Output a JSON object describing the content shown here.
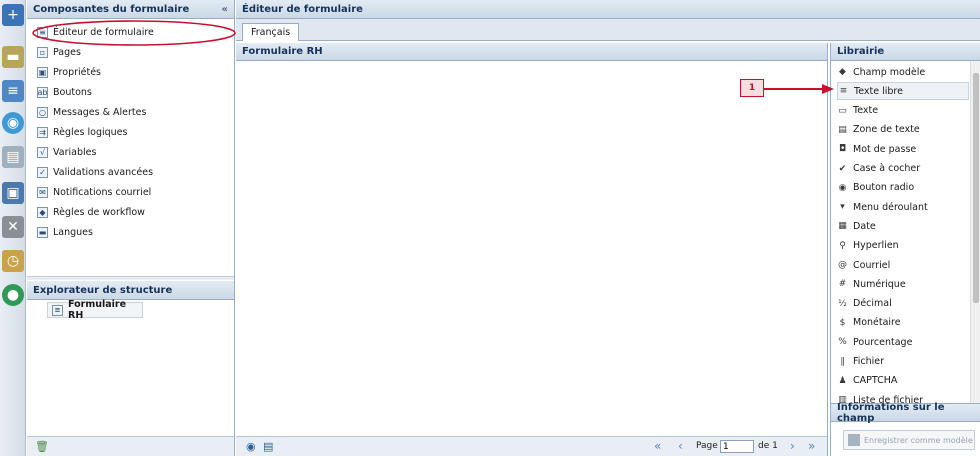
{
  "left_panel": {
    "title": "Composantes du formulaire",
    "collapse": "«",
    "items": [
      {
        "label": "Éditeur de formulaire",
        "icon": "form-editor-icon"
      },
      {
        "label": "Pages",
        "icon": "pages-icon"
      },
      {
        "label": "Propriétés",
        "icon": "properties-icon"
      },
      {
        "label": "Boutons",
        "icon": "buttons-icon"
      },
      {
        "label": "Messages & Alertes",
        "icon": "messages-icon"
      },
      {
        "label": "Règles logiques",
        "icon": "logic-rules-icon"
      },
      {
        "label": "Variables",
        "icon": "variables-icon"
      },
      {
        "label": "Validations avancées",
        "icon": "validations-icon"
      },
      {
        "label": "Notifications courriel",
        "icon": "email-notifications-icon"
      },
      {
        "label": "Règles de workflow",
        "icon": "workflow-rules-icon"
      },
      {
        "label": "Langues",
        "icon": "languages-icon"
      }
    ]
  },
  "explorer": {
    "title": "Explorateur de structure",
    "root": "Formulaire RH"
  },
  "editor": {
    "title": "Éditeur de formulaire",
    "tab": "Français",
    "form_title": "Formulaire RH",
    "pagination": {
      "page_label": "Page",
      "page_value": "1",
      "of_label": "de 1"
    }
  },
  "library": {
    "title": "Librairie",
    "items": [
      {
        "label": "Champ modèle",
        "icon": "eraser-icon"
      },
      {
        "label": "Texte libre",
        "icon": "free-text-icon"
      },
      {
        "label": "Texte",
        "icon": "text-field-icon"
      },
      {
        "label": "Zone de texte",
        "icon": "textarea-icon"
      },
      {
        "label": "Mot de passe",
        "icon": "lock-icon"
      },
      {
        "label": "Case à cocher",
        "icon": "checkbox-icon"
      },
      {
        "label": "Bouton radio",
        "icon": "radio-icon"
      },
      {
        "label": "Menu déroulant",
        "icon": "dropdown-icon"
      },
      {
        "label": "Date",
        "icon": "calendar-icon"
      },
      {
        "label": "Hyperlien",
        "icon": "link-icon"
      },
      {
        "label": "Courriel",
        "icon": "at-icon"
      },
      {
        "label": "Numérique",
        "icon": "numeric-icon"
      },
      {
        "label": "Décimal",
        "icon": "decimal-icon"
      },
      {
        "label": "Monétaire",
        "icon": "currency-icon"
      },
      {
        "label": "Pourcentage",
        "icon": "percent-icon"
      },
      {
        "label": "Fichier",
        "icon": "attachment-icon"
      },
      {
        "label": "CAPTCHA",
        "icon": "captcha-icon"
      },
      {
        "label": "Liste de fichier",
        "icon": "file-list-icon"
      }
    ]
  },
  "info_panel": {
    "title": "Informations sur le champ",
    "save_template": "Enregistrer comme modèle"
  },
  "annotation": {
    "number": "1"
  },
  "colors": {
    "header_text": "#15335a",
    "accent_red": "#c8102e",
    "border": "#99adc3"
  }
}
